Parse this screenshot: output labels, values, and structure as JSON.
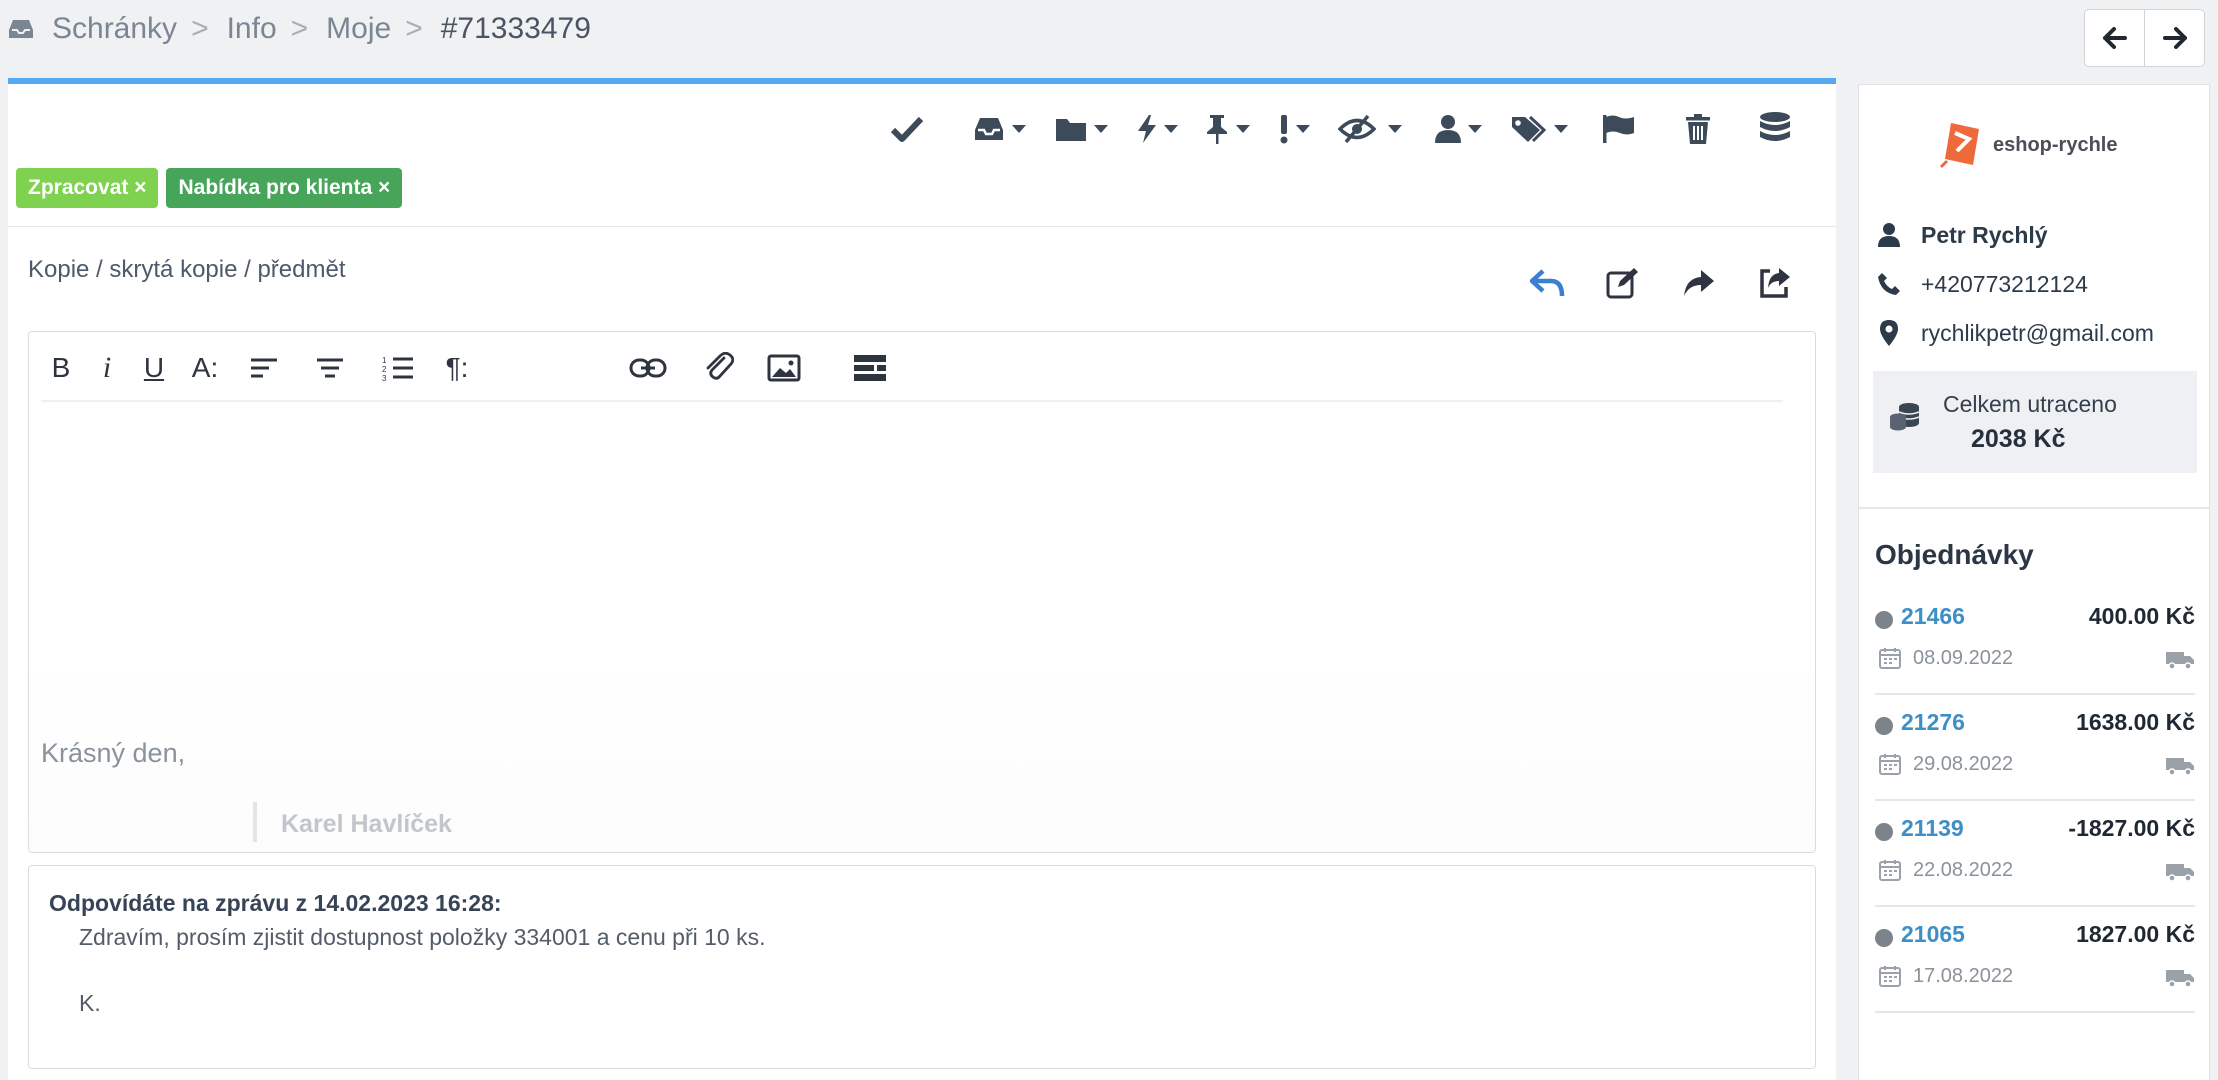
{
  "breadcrumb": {
    "items": [
      "Schránky",
      "Info",
      "Moje"
    ],
    "separator": ">",
    "current": "#71333479"
  },
  "nav": {
    "prev_icon": "arrow-left-icon",
    "next_icon": "arrow-right-icon"
  },
  "toolbar": {
    "icons": [
      "check-icon",
      "inbox-icon",
      "folder-icon",
      "bolt-icon",
      "pin-icon",
      "priority-icon",
      "eye-slash-icon",
      "user-icon",
      "tags-icon",
      "flag-icon",
      "trash-icon",
      "database-icon"
    ]
  },
  "tags": [
    {
      "label": "Zpracovat ×",
      "color": "#7fd24f"
    },
    {
      "label": "Nabídka pro klienta ×",
      "color": "#47a55a"
    }
  ],
  "compose": {
    "copy_link": "Kopie / skrytá kopie / předmět",
    "greeting": "Krásný den,",
    "signature": "Karel Havlíček"
  },
  "editor_toolbar": {
    "bold": "B",
    "italic": "i",
    "underline": "U",
    "font_size": "A:",
    "paragraph": "¶:"
  },
  "quote": {
    "heading": "Odpovídáte na zprávu z 14.02.2023 16:28:",
    "line1": "Zdravím, prosím zjistit dostupnost položky 334001 a cenu při 10 ks.",
    "line2": "K."
  },
  "customer": {
    "logo_text": "eshop-rychle",
    "name": "Petr Rychlý",
    "phone": "+420773212124",
    "email": "rychlikpetr@gmail.com",
    "spent_label": "Celkem utraceno",
    "spent_value": "2038 Kč"
  },
  "orders": {
    "title": "Objednávky",
    "items": [
      {
        "id": "21466",
        "total": "400.00 Kč",
        "date": "08.09.2022"
      },
      {
        "id": "21276",
        "total": "1638.00 Kč",
        "date": "29.08.2022"
      },
      {
        "id": "21139",
        "total": "-1827.00 Kč",
        "date": "22.08.2022"
      },
      {
        "id": "21065",
        "total": "1827.00 Kč",
        "date": "17.08.2022"
      }
    ]
  },
  "colors": {
    "accent": "#56a9f0",
    "link": "#3d8fc6",
    "tag_green_light": "#7fd24f",
    "tag_green_dark": "#47a55a"
  }
}
